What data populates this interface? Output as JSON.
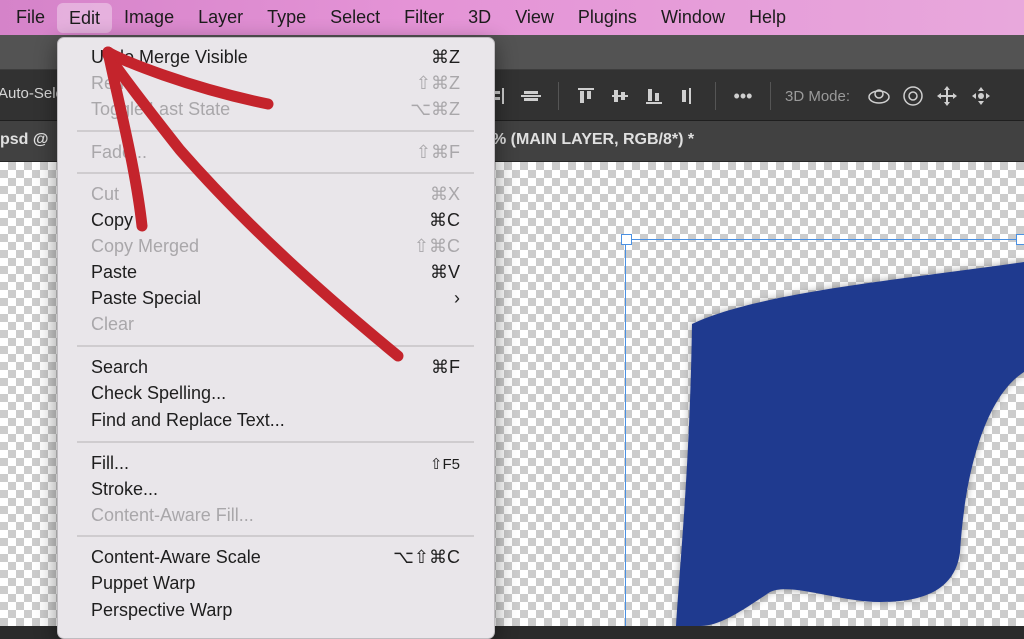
{
  "menubar": {
    "items": [
      "File",
      "Edit",
      "Image",
      "Layer",
      "Type",
      "Select",
      "Filter",
      "3D",
      "View",
      "Plugins",
      "Window",
      "Help"
    ],
    "active": "Edit"
  },
  "options_bar": {
    "auto_select_label": "Auto-Sele",
    "mode_label": "3D Mode:",
    "more_label": "•••"
  },
  "tabs": {
    "left": "psd @",
    "right": "% (MAIN LAYER, RGB/8*) *"
  },
  "edit_menu": {
    "items": [
      {
        "label": "Undo Merge Visible",
        "shortcut": "⌘Z",
        "enabled": true
      },
      {
        "label": "Redo",
        "shortcut": "⇧⌘Z",
        "enabled": false
      },
      {
        "label": "Toggle Last State",
        "shortcut": "⌥⌘Z",
        "enabled": false
      },
      {
        "label": "Fade...",
        "shortcut": "⇧⌘F",
        "enabled": false
      },
      {
        "label": "Cut",
        "shortcut": "⌘X",
        "enabled": false
      },
      {
        "label": "Copy",
        "shortcut": "⌘C",
        "enabled": true
      },
      {
        "label": "Copy Merged",
        "shortcut": "⇧⌘C",
        "enabled": false
      },
      {
        "label": "Paste",
        "shortcut": "⌘V",
        "enabled": true
      },
      {
        "label": "Paste Special",
        "shortcut": "›",
        "enabled": true
      },
      {
        "label": "Clear",
        "shortcut": "",
        "enabled": false
      },
      {
        "label": "Search",
        "shortcut": "⌘F",
        "enabled": true
      },
      {
        "label": "Check Spelling...",
        "shortcut": "",
        "enabled": true
      },
      {
        "label": "Find and Replace Text...",
        "shortcut": "",
        "enabled": true
      },
      {
        "label": "Fill...",
        "shortcut": "⇧F5",
        "enabled": true
      },
      {
        "label": "Stroke...",
        "shortcut": "",
        "enabled": true
      },
      {
        "label": "Content-Aware Fill...",
        "shortcut": "",
        "enabled": false
      },
      {
        "label": "Content-Aware Scale",
        "shortcut": "⌥⇧⌘C",
        "enabled": true
      },
      {
        "label": "Puppet Warp",
        "shortcut": "",
        "enabled": true
      },
      {
        "label": "Perspective Warp",
        "shortcut": "",
        "enabled": true
      }
    ]
  },
  "colors": {
    "annotation_arrow": "#c4242c",
    "shape_fill": "#1f3a8f",
    "selection": "#4a90e2"
  }
}
